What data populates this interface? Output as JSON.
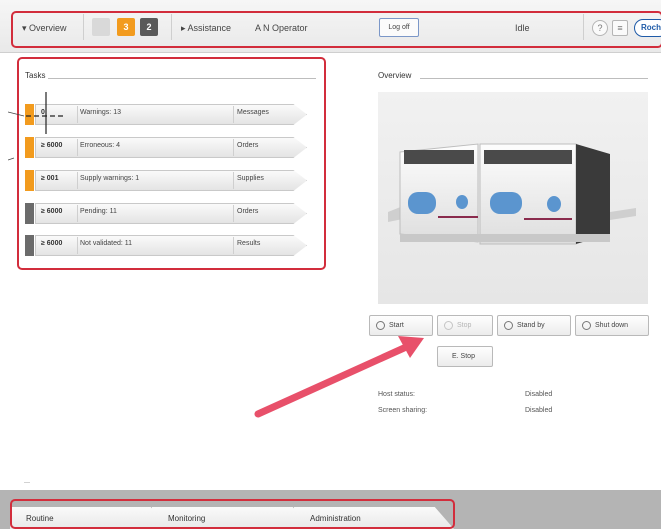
{
  "topbar": {
    "overview_label": "▾ Overview",
    "badge_orange": "3",
    "badge_dark": "2",
    "assistance_label": "▸ Assistance",
    "operator": "A N Operator",
    "logoff_label": "Log off",
    "status": "Idle",
    "brand": "Roche"
  },
  "tasks": {
    "title": "Tasks",
    "rows": [
      {
        "count": "0",
        "description": "Warnings: 13",
        "category": "Messages",
        "color": "#f29b1e"
      },
      {
        "count": "≥ 6000",
        "description": "Erroneous: 4",
        "category": "Orders",
        "color": "#f29b1e"
      },
      {
        "count": "≥ 001",
        "description": "Supply warnings: 1",
        "category": "Supplies",
        "color": "#f29b1e"
      },
      {
        "count": "≥ 6000",
        "description": "Pending: 11",
        "category": "Orders",
        "color": "#6b6b6b"
      },
      {
        "count": "≥ 6000",
        "description": "Not validated: 11",
        "category": "Results",
        "color": "#6b6b6b"
      }
    ]
  },
  "overview": {
    "title": "Overview",
    "buttons": {
      "start": "Start",
      "stop": "Stop",
      "standby": "Stand by",
      "shutdown": "Shut down",
      "estop": "E. Stop"
    },
    "status": [
      {
        "label": "Host status:",
        "value": "Disabled"
      },
      {
        "label": "Screen sharing:",
        "value": "Disabled"
      }
    ]
  },
  "nav": {
    "tabs": [
      "Routine",
      "Monitoring",
      "Administration"
    ]
  },
  "colors": {
    "accent_orange": "#f29b1e",
    "dark_grey": "#6b6b6b",
    "highlight_red": "#d22d3c",
    "annotation_pink": "#e8506a",
    "roche_blue": "#1f5ba8"
  }
}
